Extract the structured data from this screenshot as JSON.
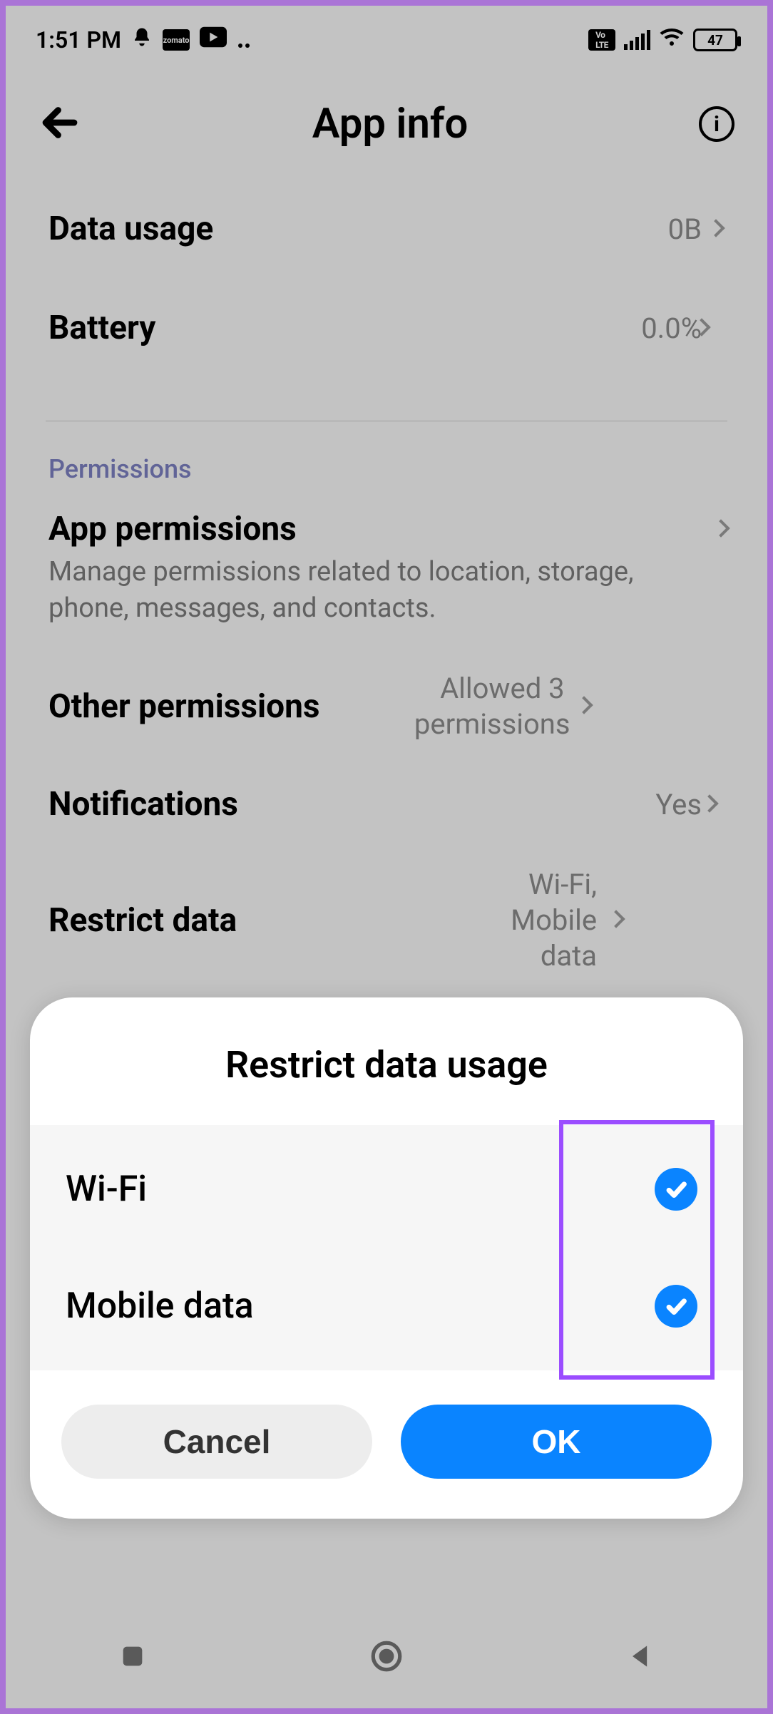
{
  "status": {
    "time": "1:51 PM",
    "battery": "47"
  },
  "title": "App info",
  "rows": {
    "data_usage": {
      "label": "Data usage",
      "value": "0B"
    },
    "battery": {
      "label": "Battery",
      "value": "0.0%"
    }
  },
  "permissions_header": "Permissions",
  "app_permissions": {
    "label": "App permissions",
    "desc": "Manage permissions related to location, storage, phone, messages, and contacts."
  },
  "other_permissions": {
    "label": "Other permissions",
    "value": "Allowed 3 permissions"
  },
  "notifications": {
    "label": "Notifications",
    "value": "Yes"
  },
  "restrict_row": {
    "label": "Restrict data",
    "value": "Wi-Fi, Mobile data"
  },
  "modal": {
    "title": "Restrict data usage",
    "wifi": "Wi-Fi",
    "mobile": "Mobile data",
    "cancel": "Cancel",
    "ok": "OK"
  }
}
